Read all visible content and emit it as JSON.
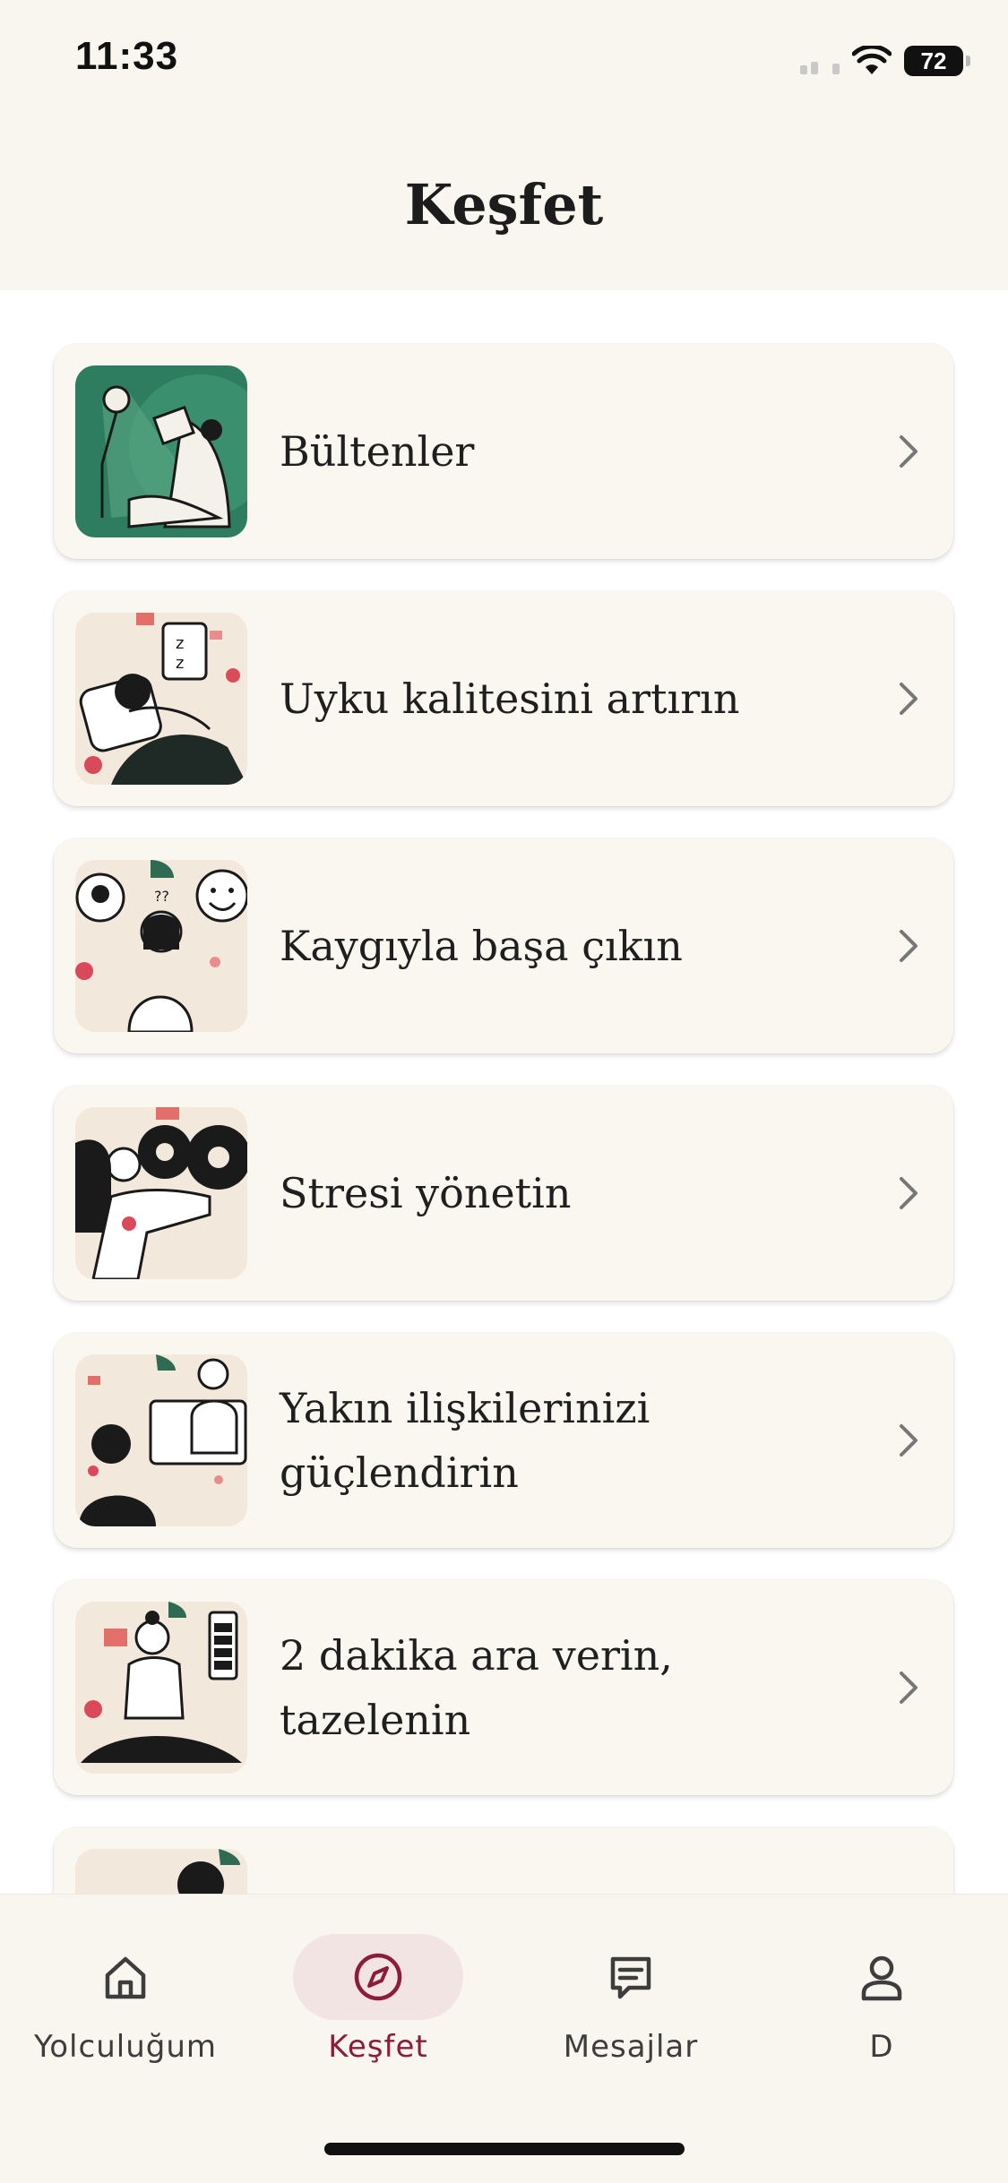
{
  "status_bar": {
    "time": "11:33",
    "battery": "72",
    "icons": [
      "cellular-signal-icon",
      "wifi-icon",
      "battery-icon"
    ]
  },
  "header": {
    "title": "Keşfet"
  },
  "topics": [
    {
      "label": "Bültenler",
      "icon": "woman-reading-illustration"
    },
    {
      "label": "Uyku kalitesini artırın",
      "icon": "sleeping-person-illustration"
    },
    {
      "label": "Kaygıyla başa çıkın",
      "icon": "thinking-person-illustration"
    },
    {
      "label": "Stresi yönetin",
      "icon": "woman-with-gears-illustration"
    },
    {
      "label": "Yakın ilişkilerinizi güçlendirin",
      "icon": "video-call-illustration"
    },
    {
      "label": "2 dakika ara verin, tazelenin",
      "icon": "meditation-illustration"
    }
  ],
  "tab_bar": {
    "tabs": [
      {
        "label": "Yolculuğum",
        "icon": "home-icon",
        "active": false
      },
      {
        "label": "Keşfet",
        "icon": "compass-icon",
        "active": true
      },
      {
        "label": "Mesajlar",
        "icon": "message-icon",
        "active": false
      },
      {
        "label": "D",
        "icon": "profile-icon",
        "active": false
      }
    ]
  },
  "colors": {
    "background": "#ffffff",
    "header_bg": "#f8f6ef",
    "card_bg": "#faf7f0",
    "accent": "#8c1d3a",
    "active_tab_pill": "#f1e4e2",
    "text": "#1f1f1f"
  }
}
